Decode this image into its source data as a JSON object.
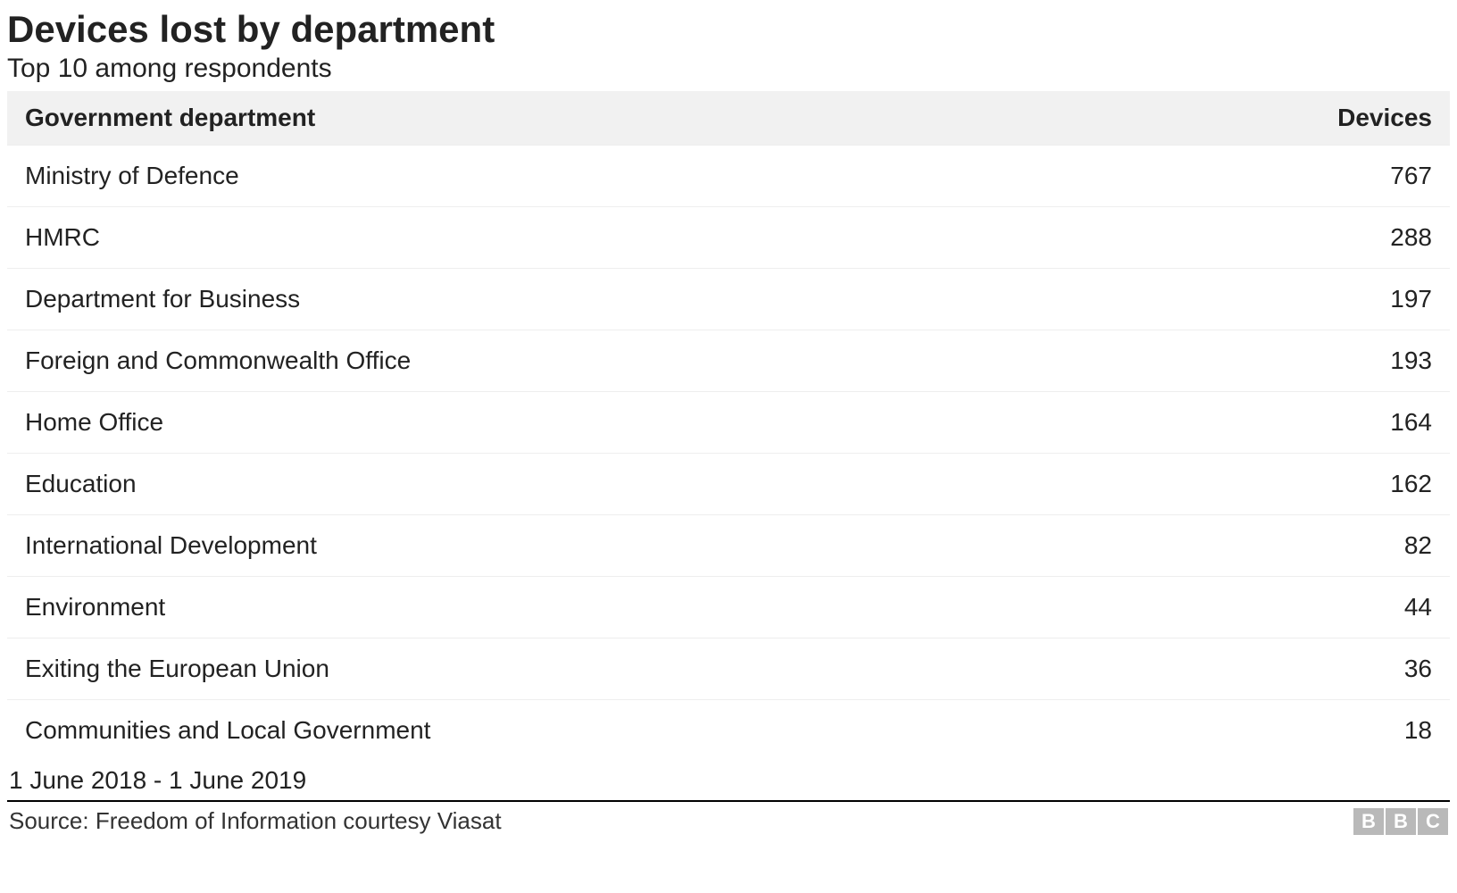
{
  "title": "Devices lost by department",
  "subtitle": "Top 10 among respondents",
  "columns": {
    "dept": "Government department",
    "devices": "Devices"
  },
  "date_range": "1 June 2018 - 1 June 2019",
  "source": "Source: Freedom of Information courtesy Viasat",
  "logo_letters": [
    "B",
    "B",
    "C"
  ],
  "chart_data": {
    "type": "table",
    "title": "Devices lost by department",
    "subtitle": "Top 10 among respondents",
    "columns": [
      "Government department",
      "Devices"
    ],
    "rows": [
      {
        "department": "Ministry of Defence",
        "devices": 767
      },
      {
        "department": "HMRC",
        "devices": 288
      },
      {
        "department": "Department for Business",
        "devices": 197
      },
      {
        "department": "Foreign and Commonwealth Office",
        "devices": 193
      },
      {
        "department": "Home Office",
        "devices": 164
      },
      {
        "department": "Education",
        "devices": 162
      },
      {
        "department": "International Development",
        "devices": 82
      },
      {
        "department": "Environment",
        "devices": 44
      },
      {
        "department": "Exiting the European Union",
        "devices": 36
      },
      {
        "department": "Communities and Local Government",
        "devices": 18
      }
    ],
    "date_range": "1 June 2018 - 1 June 2019",
    "source": "Freedom of Information courtesy Viasat"
  }
}
